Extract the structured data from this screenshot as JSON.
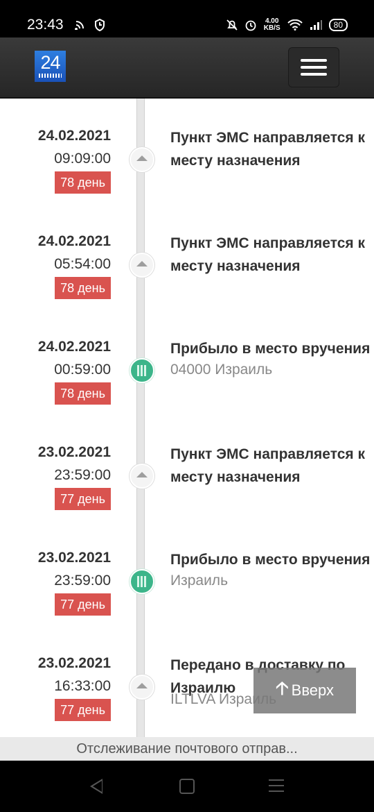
{
  "status_bar": {
    "time": "23:43",
    "speed_value": "4.00",
    "speed_unit": "KB/S",
    "battery": "80"
  },
  "header": {
    "logo_text": "24"
  },
  "events": [
    {
      "date": "24.02.2021",
      "time": "09:09:00",
      "days": "78 день",
      "title": "Пункт ЭМС направляется к\nместу назначения",
      "subtitle": "",
      "icon": "arrow-up-icon"
    },
    {
      "date": "24.02.2021",
      "time": "05:54:00",
      "days": "78 день",
      "title": "Пункт ЭМС направляется к\nместу назначения",
      "subtitle": "",
      "icon": "arrow-up-icon"
    },
    {
      "date": "24.02.2021",
      "time": "00:59:00",
      "days": "78 день",
      "title": "Прибыло в место вручения",
      "subtitle": "04000 Израиль",
      "icon": "building-icon"
    },
    {
      "date": "23.02.2021",
      "time": "23:59:00",
      "days": "77 день",
      "title": "Пункт ЭМС направляется к\nместу назначения",
      "subtitle": "",
      "icon": "arrow-up-icon"
    },
    {
      "date": "23.02.2021",
      "time": "23:59:00",
      "days": "77 день",
      "title": "Прибыло в место вручения",
      "subtitle": "Израиль",
      "icon": "building-icon"
    },
    {
      "date": "23.02.2021",
      "time": "16:33:00",
      "days": "77 день",
      "title": "Передано в доставку по\nИзраилю",
      "subtitle": "ILTLVA Израиль",
      "icon": "arrow-up-icon"
    }
  ],
  "top_button": {
    "label": "Вверх"
  },
  "footer": {
    "tab_title": "Отслеживание почтового отправ..."
  },
  "colors": {
    "badge": "#d9534f",
    "node_green": "#3cb58a",
    "header_bg": "#2e2e2e"
  }
}
